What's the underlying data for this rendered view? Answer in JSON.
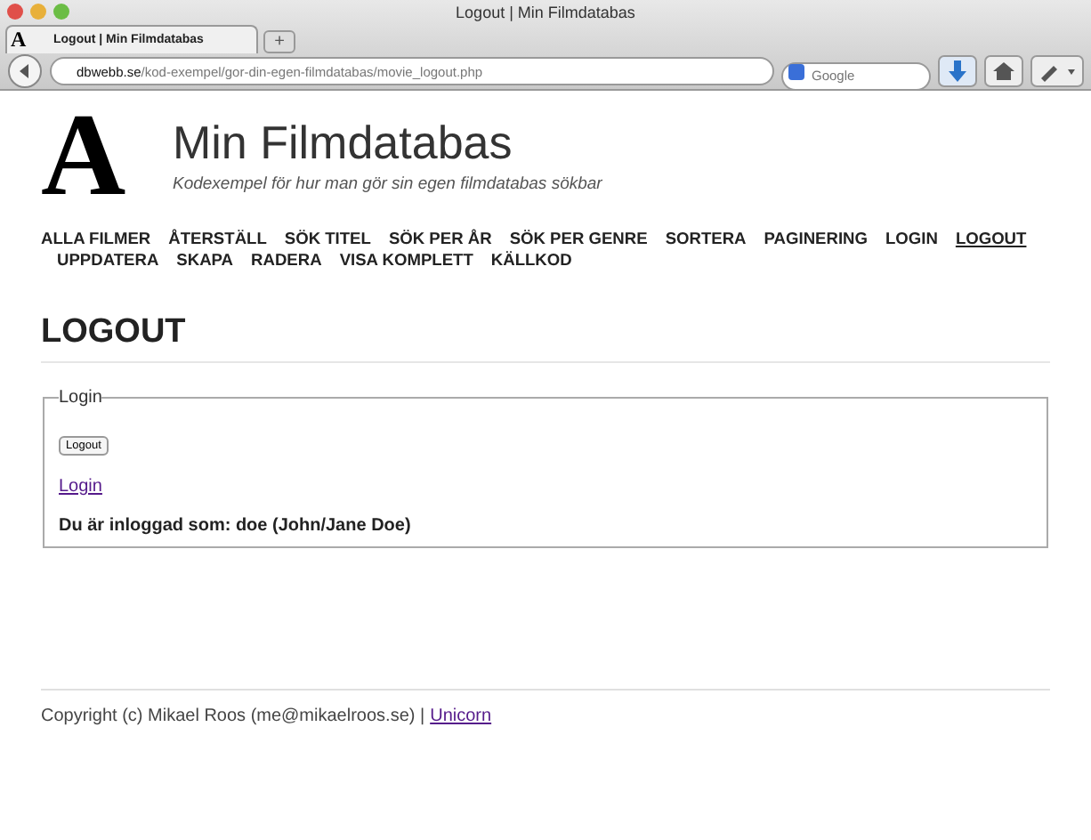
{
  "window": {
    "title": "Logout | Min Filmdatabas"
  },
  "tabs": [
    {
      "favicon": "A",
      "label": "Logout | Min Filmdatabas",
      "selected": true
    }
  ],
  "new_tab": "+",
  "address_bar": {
    "domain": "dbwebb.se",
    "path": "/kod-exempel/gor-din-egen-filmdatabas/movie_logout.php"
  },
  "search": {
    "placeholder": "Google"
  },
  "header": {
    "logo": "A",
    "title": "Min Filmdatabas",
    "slogan": "Kodexempel för hur man gör sin egen filmdatabas sökbar"
  },
  "nav_rows": [
    [
      {
        "label": "ALLA FILMER",
        "selected": false
      },
      {
        "label": "ÅTERSTÄLL",
        "selected": false
      },
      {
        "label": "SÖK TITEL",
        "selected": false
      },
      {
        "label": "SÖK PER ÅR",
        "selected": false
      },
      {
        "label": "SÖK PER GENRE",
        "selected": false
      },
      {
        "label": "SORTERA",
        "selected": false
      },
      {
        "label": "PAGINERING",
        "selected": false
      },
      {
        "label": "LOGIN",
        "selected": false
      },
      {
        "label": "LOGOUT",
        "selected": true
      }
    ],
    [
      {
        "label": "UPPDATERA",
        "selected": false
      },
      {
        "label": "SKAPA",
        "selected": false
      },
      {
        "label": "RADERA",
        "selected": false
      },
      {
        "label": "VISA KOMPLETT",
        "selected": false
      },
      {
        "label": "KÄLLKOD",
        "selected": false
      }
    ]
  ],
  "heading": "LOGOUT",
  "form": {
    "legend": "Login",
    "button": "Logout",
    "link": "Login",
    "status": "Du är inloggad som: doe (John/Jane Doe)"
  },
  "footer": {
    "text": "Copyright (c) Mikael Roos (me@mikaelroos.se) |",
    "link": "Unicorn"
  }
}
